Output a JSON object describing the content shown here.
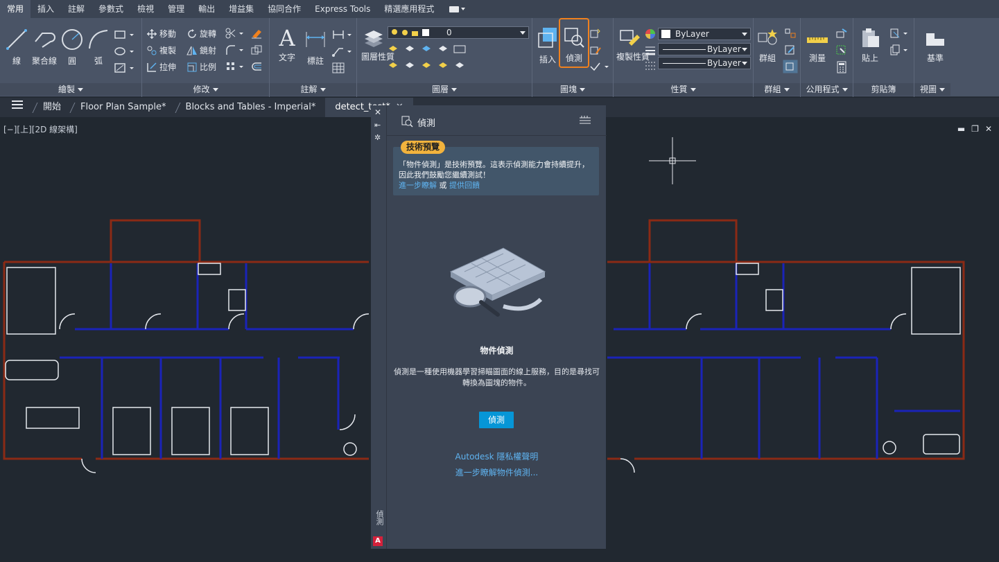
{
  "ribbon_tabs": [
    "常用",
    "插入",
    "註解",
    "參數式",
    "檢視",
    "管理",
    "輸出",
    "增益集",
    "協同合作",
    "Express Tools",
    "精選應用程式"
  ],
  "active_tab": "常用",
  "draw_panel": {
    "title": "繪製",
    "line": "線",
    "polyline": "聚合線",
    "circle": "圓",
    "arc": "弧"
  },
  "modify_panel": {
    "title": "修改",
    "move": "移動",
    "rotate": "旋轉",
    "copy": "複製",
    "mirror": "鏡射",
    "stretch": "拉伸",
    "scale": "比例"
  },
  "annotation_panel": {
    "title": "註解",
    "text": "文字",
    "dimension": "標註"
  },
  "layers_panel": {
    "title": "圖層",
    "layer_props": "圖層性質",
    "layer_value": "0"
  },
  "block_panel": {
    "title": "圖塊",
    "insert": "插入",
    "detect": "偵測"
  },
  "properties_panel": {
    "title": "性質",
    "match": "複製性質",
    "color": "ByLayer",
    "linetype": "ByLayer",
    "lineweight": "ByLayer"
  },
  "groups_panel": {
    "title": "群組",
    "group": "群組"
  },
  "utilities_panel": {
    "title": "公用程式",
    "measure": "測量"
  },
  "clipboard_panel": {
    "title": "剪貼簿",
    "paste": "貼上"
  },
  "view_panel": {
    "title": "視圖",
    "base": "基準"
  },
  "file_tabs": [
    "開始",
    "Floor Plan Sample*",
    "Blocks and Tables - Imperial*",
    "detect_test*"
  ],
  "active_file_tab": "detect_test*",
  "viewport_label": "[−][上][2D 線架構]",
  "palette": {
    "title": "偵測",
    "side_label": "偵測",
    "badge": "技術預覽",
    "notice_text": "「物件偵測」是技術預覽。這表示偵測能力會持續提升，因此我們鼓勵您繼續測試！",
    "notice_link1": "進一步瞭解",
    "notice_or": " 或 ",
    "notice_link2": "提供回饋",
    "feature_title": "物件偵測",
    "description": "偵測是一種使用機器學習掃瞄圖面的線上服務，目的是尋找可轉換為圖塊的物件。",
    "button": "偵測",
    "privacy_link": "Autodesk 隱私權聲明",
    "learn_link": "進一步瞭解物件偵測..."
  },
  "colors": {
    "wall_red": "#8b2a15",
    "wall_blue": "#1a23b8",
    "accent": "#0696d7",
    "badge": "#f2b33d",
    "highlight": "#f0811e"
  }
}
